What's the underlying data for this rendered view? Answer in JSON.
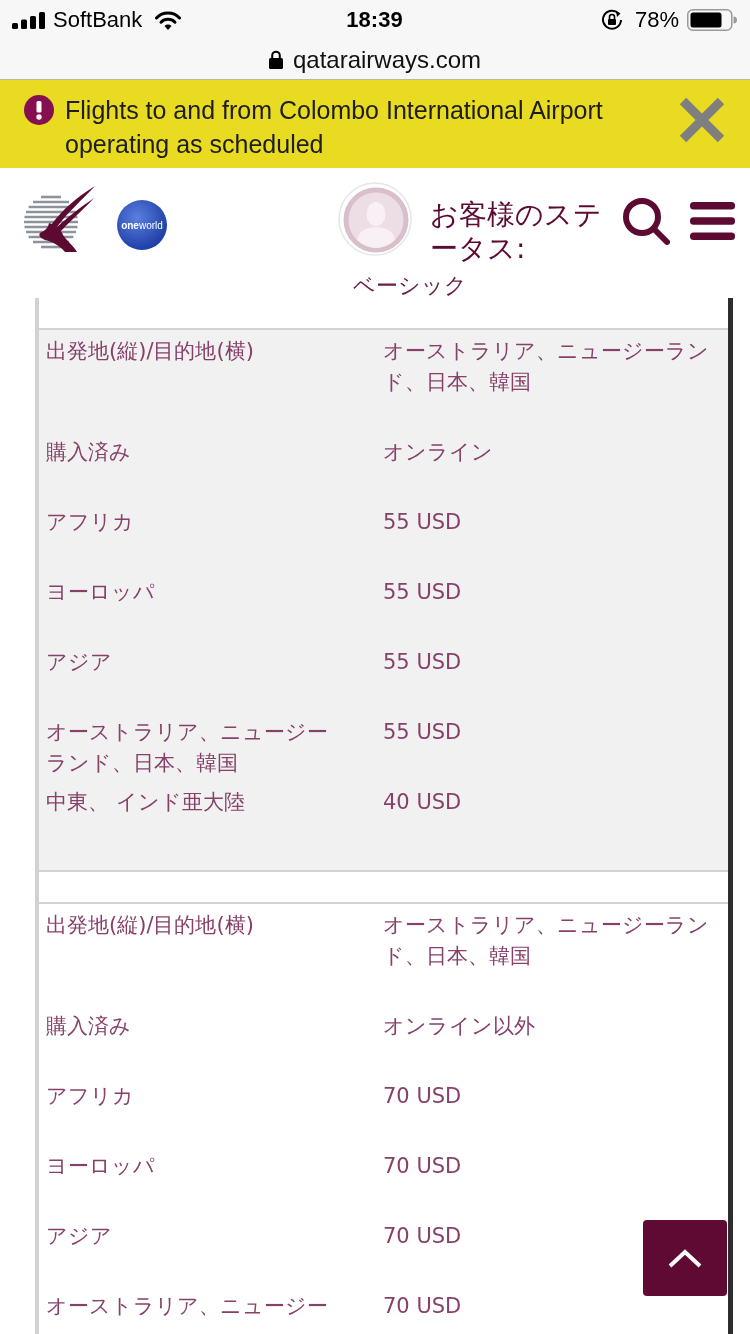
{
  "status_bar": {
    "carrier": "SoftBank",
    "time": "18:39",
    "battery": "78%"
  },
  "address_bar": {
    "url": "qatarairways.com"
  },
  "alert_banner": {
    "message": "Flights to and from Colombo International Airport operating as scheduled"
  },
  "header": {
    "alliance_badge": "**one**world",
    "status_label": "お客様のステータス:",
    "status_value": "ベーシック"
  },
  "fare_tables": [
    {
      "shaded": true,
      "rows": [
        {
          "label": "出発地(縦)/目的地(横)",
          "value": "オーストラリア、ニュージーランド、日本、韓国"
        },
        {
          "label": "購入済み",
          "value": "オンライン"
        },
        {
          "label": "アフリカ",
          "value": "55 USD"
        },
        {
          "label": "ヨーロッパ",
          "value": "55 USD"
        },
        {
          "label": "アジア",
          "value": "55 USD"
        },
        {
          "label": "オーストラリア、ニュージーランド、日本、韓国",
          "value": "55 USD"
        },
        {
          "label": "中東、 インド亜大陸",
          "value": "40 USD"
        }
      ]
    },
    {
      "shaded": false,
      "rows": [
        {
          "label": "出発地(縦)/目的地(横)",
          "value": "オーストラリア、ニュージーランド、日本、韓国"
        },
        {
          "label": "購入済み",
          "value": "オンライン以外"
        },
        {
          "label": "アフリカ",
          "value": "70 USD"
        },
        {
          "label": "ヨーロッパ",
          "value": "70 USD"
        },
        {
          "label": "アジア",
          "value": "70 USD"
        },
        {
          "label": "オーストラリア、ニュージー",
          "value": "70 USD"
        }
      ]
    }
  ]
}
